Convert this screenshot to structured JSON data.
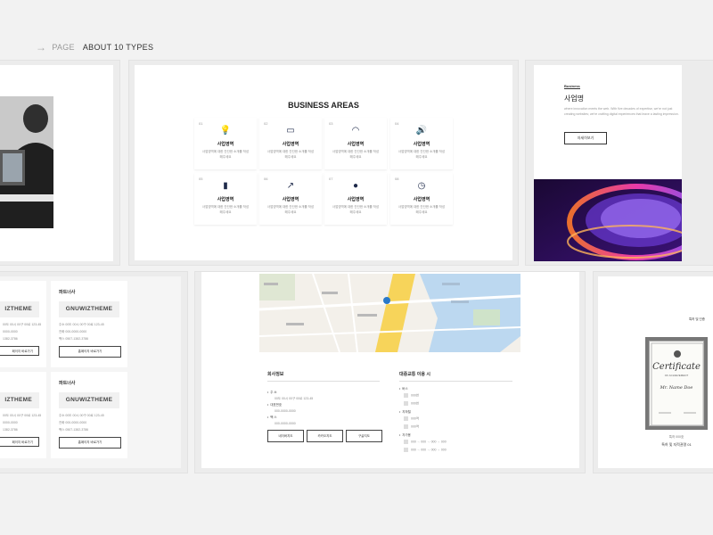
{
  "header": {
    "arrow": "→",
    "label": "PAGE",
    "strong": "ABOUT 10 TYPES"
  },
  "business": {
    "title": "BUSINESS AREAS",
    "cards": [
      {
        "num": "01",
        "icon": "bulb-icon",
        "glyph": "💡",
        "title": "사업영역",
        "desc": "사업영역에 대한 간단한 소개를 작성해주세요"
      },
      {
        "num": "02",
        "icon": "monitor-icon",
        "glyph": "▭",
        "title": "사업영역",
        "desc": "사업영역에 대한 간단한 소개를 작성해주세요"
      },
      {
        "num": "03",
        "icon": "wifi-icon",
        "glyph": "◠",
        "title": "사업영역",
        "desc": "사업영역에 대한 간단한 소개를 작성해주세요"
      },
      {
        "num": "04",
        "icon": "speaker-icon",
        "glyph": "🔊",
        "title": "사업영역",
        "desc": "사업영역에 대한 간단한 소개를 작성해주세요"
      },
      {
        "num": "05",
        "icon": "bar-chart-icon",
        "glyph": "▮",
        "title": "사업영역",
        "desc": "사업영역에 대한 간단한 소개를 작성해주세요"
      },
      {
        "num": "06",
        "icon": "trending-icon",
        "glyph": "↗",
        "title": "사업영역",
        "desc": "사업영역에 대한 간단한 소개를 작성해주세요"
      },
      {
        "num": "07",
        "icon": "location-pin-icon",
        "glyph": "●",
        "title": "사업영역",
        "desc": "사업영역에 대한 간단한 소개를 작성해주세요"
      },
      {
        "num": "08",
        "icon": "clock-icon",
        "glyph": "◷",
        "title": "사업영역",
        "desc": "사업영역에 대한 간단한 소개를 작성해주세요"
      }
    ]
  },
  "biz": {
    "tag": "Business",
    "title": "사업명",
    "desc": "where innovation meets the web. With five decades of expertise, we're not just creating websites; we're crafting digital experiences that leave a lasting impression.",
    "button": "자세히보기"
  },
  "partners": {
    "left_name": "파트너사",
    "left_logo": "IZTHEME",
    "right_name": "파트너사",
    "logo": "GNUWIZTHEME",
    "address": "주소 00도 00시 00구 00로 123-45",
    "address_left": "00도 00시 00구 00로 123-45",
    "phone": "전화 000-0000-0000",
    "phone_left": "0000-0000",
    "fax": "팩스 0507-1382-3786",
    "fax_left": "1382-3786",
    "button": "홈페이지 바로가기",
    "button_left": "페이지 바로가기"
  },
  "contact": {
    "company": {
      "title": "회사정보",
      "addr_label": "주 소",
      "addr": "00도 00시 00구 00로 123-45",
      "tel_label": "대표번호",
      "tel": "000-0000-0000",
      "fax_label": "팩 스",
      "fax": "000-0000-0000",
      "buttons": [
        "네이버지도",
        "카카오지도",
        "구글지도"
      ]
    },
    "transit": {
      "title": "대중교통 이용 시",
      "bus": "버스",
      "bus_items": [
        "000번",
        "000번"
      ],
      "subway": "지하철",
      "subway_items": [
        "000역",
        "000역"
      ],
      "car": "자가용",
      "car_items": [
        "000 → 000 → 000 → 000",
        "000 → 000 → 000 → 000"
      ]
    }
  },
  "certificate": {
    "ribbon": "특허 및 인증",
    "title": "Certificate",
    "sub": "OF ACHIEVEMENT",
    "name": "Mr. Name Doe",
    "cap1": "특허 000호",
    "cap2": "특허 및 지적권명 01"
  }
}
